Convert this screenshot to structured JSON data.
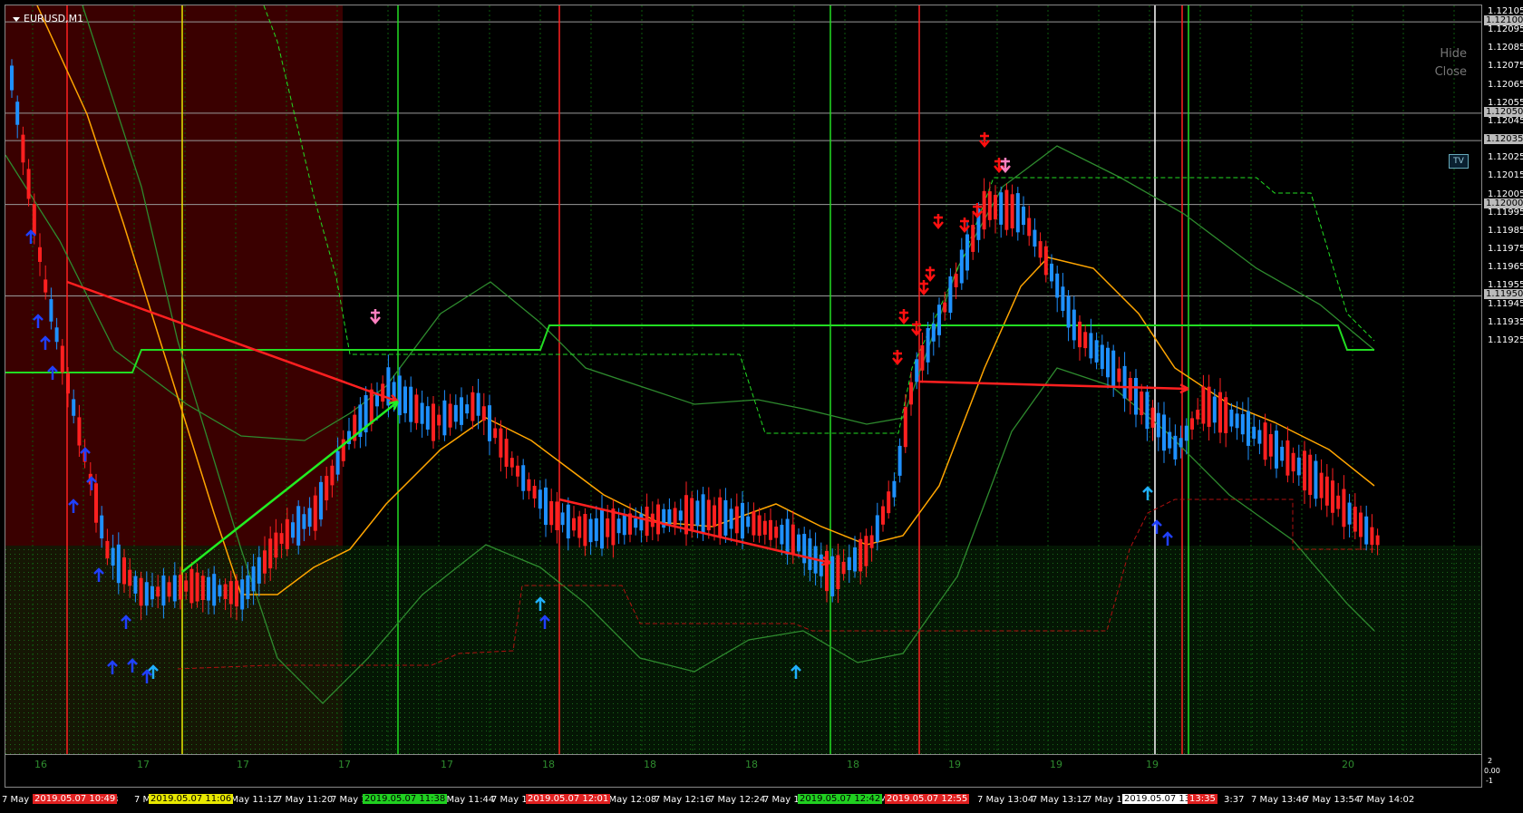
{
  "window": {
    "symbol_label": "EURUSD,M1",
    "hide_button": "Hide",
    "close_button": "Close",
    "tv_badge": "TV"
  },
  "price_axis": {
    "ticks": [
      "1.12105",
      "1.12095",
      "1.12085",
      "1.12075",
      "1.12065",
      "1.12055",
      "1.12045",
      "1.12035",
      "1.12025",
      "1.12015",
      "1.12005",
      "1.11995",
      "1.11985",
      "1.11975",
      "1.11965",
      "1.11955",
      "1.11945",
      "1.11935",
      "1.11925"
    ],
    "tick_values": [
      1.12105,
      1.12095,
      1.12085,
      1.12075,
      1.12065,
      1.12055,
      1.12045,
      1.12035,
      1.12025,
      1.12015,
      1.12005,
      1.11995,
      1.11985,
      1.11975,
      1.11965,
      1.11955,
      1.11945,
      1.11935,
      1.11925
    ],
    "highlighted": [
      {
        "text": "1.12100",
        "value": 1.121
      },
      {
        "text": "1.12050",
        "value": 1.1205
      },
      {
        "text": "1.12035",
        "value": 1.12035
      },
      {
        "text": "1.12000",
        "value": 1.12
      },
      {
        "text": "1.11950",
        "value": 1.1195
      }
    ]
  },
  "sub_panel": {
    "labels": [
      "16",
      "17",
      "17",
      "17",
      "17",
      "18",
      "18",
      "18",
      "18",
      "19",
      "19",
      "19",
      "20"
    ],
    "axis_top": "2",
    "axis_mid": "0.00",
    "axis_bottom": "-1"
  },
  "time_axis": {
    "labels": [
      "7 May 2",
      "8",
      "7 May 10",
      "7 May 11:12",
      "7 May 11:20",
      "7 May 11",
      "7 May 11:44",
      "7 May 11",
      "7 May 12:08",
      "7 May 12:16",
      "7 May 12:24",
      "7 May 12",
      "7 M",
      "2:56",
      "7 May 13:04",
      "7 May 13:12",
      "7 May 13",
      "3:37",
      "7 May 13:46",
      "7 May 13:54",
      "7 May 14:02"
    ],
    "marked": [
      {
        "text": "2019.05.07 10:49",
        "color": "#e02020",
        "fg": "#ffffff"
      },
      {
        "text": "2019.05.07 11:06",
        "color": "#e8e800",
        "fg": "#000000"
      },
      {
        "text": "2019.05.07 11:38",
        "color": "#20d020",
        "fg": "#000000"
      },
      {
        "text": "2019.05.07 12:01",
        "color": "#e02020",
        "fg": "#ffffff"
      },
      {
        "text": "2019.05.07 12:42",
        "color": "#20d020",
        "fg": "#000000"
      },
      {
        "text": "2019.05.07 12:55",
        "color": "#e02020",
        "fg": "#ffffff"
      },
      {
        "text": "2019.05.07 13:31",
        "color": "#ffffff",
        "fg": "#000000"
      },
      {
        "text": "13:35",
        "color": "#e02020",
        "fg": "#ffffff"
      }
    ]
  },
  "colors": {
    "bull": "#1e90ff",
    "bear": "#ff2020",
    "ma": "#ffa500",
    "band": "#2e8b2e",
    "bright_green": "#22dd22",
    "shade": "#3a0000",
    "vline_red": "#ff2020",
    "vline_green": "#22dd22",
    "vline_yellow": "#e8e800",
    "vline_white": "#ffffff"
  }
}
